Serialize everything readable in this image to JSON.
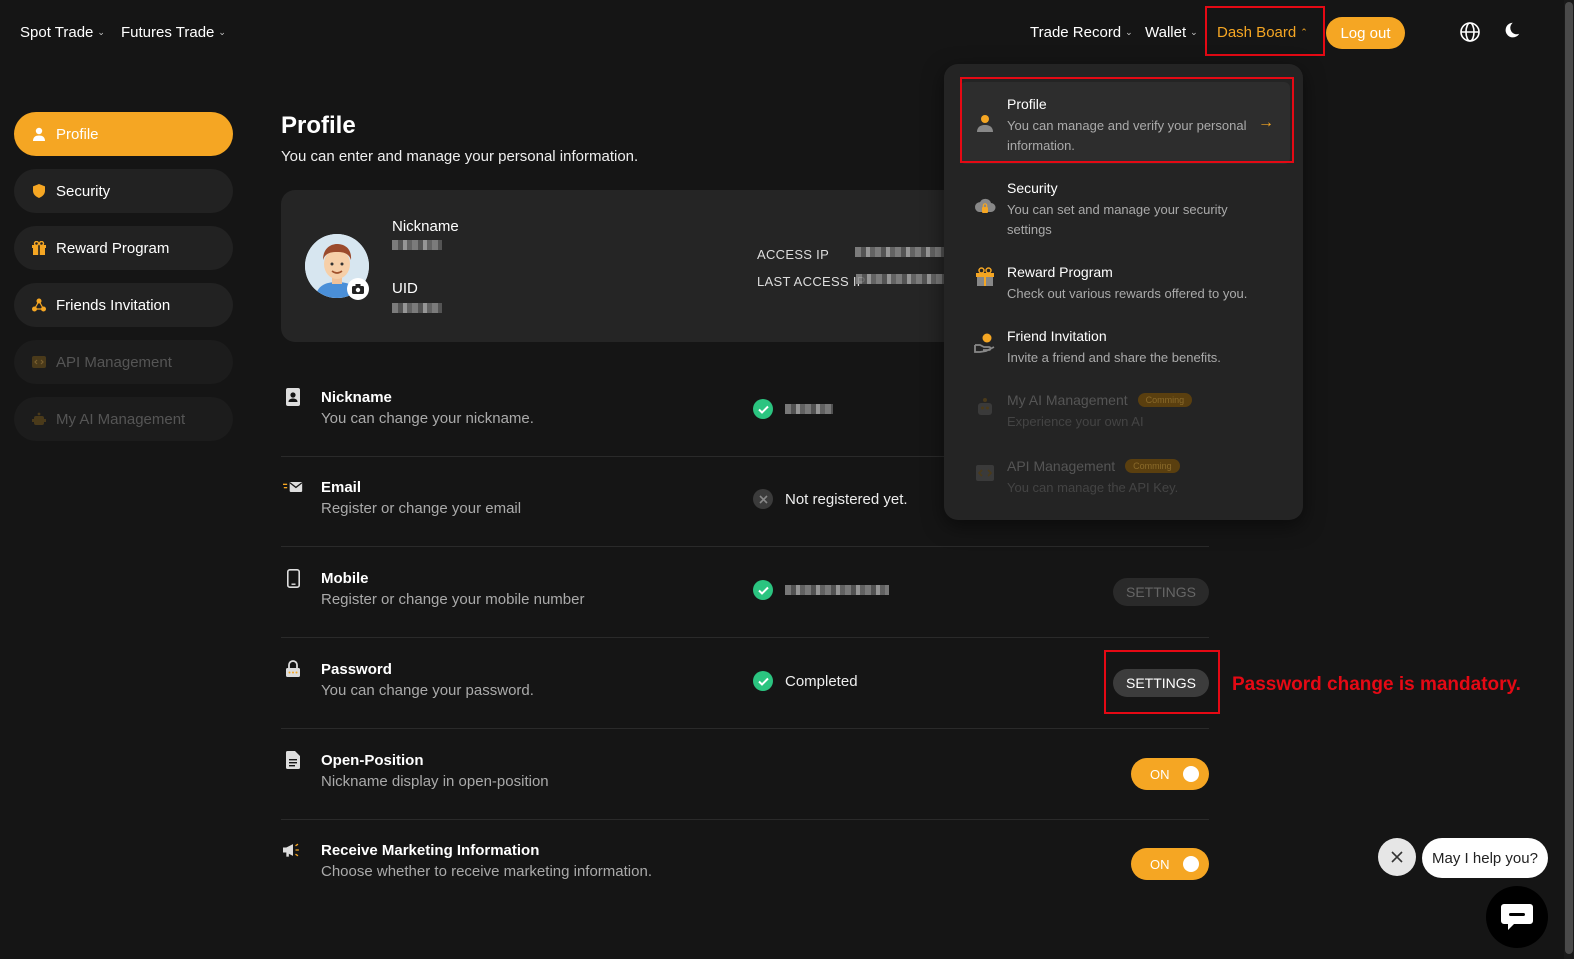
{
  "nav": {
    "left": [
      "Spot Trade",
      "Futures Trade"
    ],
    "right": [
      "Trade Record",
      "Wallet"
    ],
    "dashboard": "Dash Board",
    "logout": "Log out"
  },
  "sidebar": {
    "items": [
      {
        "label": "Profile"
      },
      {
        "label": "Security"
      },
      {
        "label": "Reward Program"
      },
      {
        "label": "Friends Invitation"
      },
      {
        "label": "API Management"
      },
      {
        "label": "My AI Management"
      }
    ]
  },
  "main": {
    "title": "Profile",
    "subtitle": "You can enter and manage your personal information.",
    "card": {
      "nickname_label": "Nickname",
      "uid_label": "UID",
      "access_ip_label": "ACCESS IP",
      "last_access_ip_label": "LAST ACCESS IP"
    },
    "rows": [
      {
        "title": "Nickname",
        "desc": "You can change your nickname.",
        "status": ""
      },
      {
        "title": "Email",
        "desc": "Register or change your email",
        "status": "Not registered yet."
      },
      {
        "title": "Mobile",
        "desc": "Register or change your mobile number",
        "status": "",
        "button": "SETTINGS"
      },
      {
        "title": "Password",
        "desc": "You can change your password.",
        "status": "Completed",
        "button": "SETTINGS"
      },
      {
        "title": "Open-Position",
        "desc": "Nickname display in open-position",
        "toggle": "ON"
      },
      {
        "title": "Receive Marketing Information",
        "desc": "Choose whether to receive marketing information.",
        "toggle": "ON"
      }
    ]
  },
  "annotation": "Password change is mandatory.",
  "dropdown": {
    "items": [
      {
        "title": "Profile",
        "desc": "You can manage and verify your personal information."
      },
      {
        "title": "Security",
        "desc": "You can set and manage your security settings"
      },
      {
        "title": "Reward Program",
        "desc": "Check out various rewards offered to you."
      },
      {
        "title": "Friend Invitation",
        "desc": "Invite a friend and share the benefits."
      },
      {
        "title": "My AI Management",
        "desc": "Experience your own AI",
        "badge": "Comming"
      },
      {
        "title": "API Management",
        "desc": "You can manage the API Key.",
        "badge": "Comming"
      }
    ]
  },
  "chat": {
    "bubble": "May I help you?"
  },
  "colors": {
    "accent": "#f5a623",
    "background": "#151515",
    "annotation": "#e50914",
    "success": "#2bc480"
  }
}
